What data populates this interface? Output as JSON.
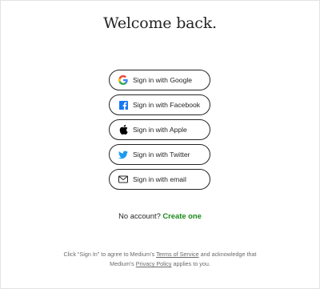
{
  "page": {
    "title": "Welcome back."
  },
  "providers": [
    {
      "label": "Sign in with Google",
      "icon": "google-icon"
    },
    {
      "label": "Sign in with Facebook",
      "icon": "facebook-icon"
    },
    {
      "label": "Sign in with Apple",
      "icon": "apple-icon"
    },
    {
      "label": "Sign in with Twitter",
      "icon": "twitter-icon"
    },
    {
      "label": "Sign in with email",
      "icon": "mail-icon"
    }
  ],
  "signup": {
    "prompt": "No account?",
    "link": "Create one"
  },
  "legal": {
    "part1": "Click “Sign In” to agree to Medium’s ",
    "terms_link": "Terms of Service",
    "part2": " and acknowledge that",
    "part3": "Medium’s ",
    "privacy_link": "Privacy Policy",
    "part4": " applies to you."
  },
  "colors": {
    "accent_green": "#1a8917",
    "facebook_blue": "#1877f2",
    "twitter_blue": "#1d9bf0",
    "text": "#242424",
    "muted": "#6b6b6b"
  }
}
